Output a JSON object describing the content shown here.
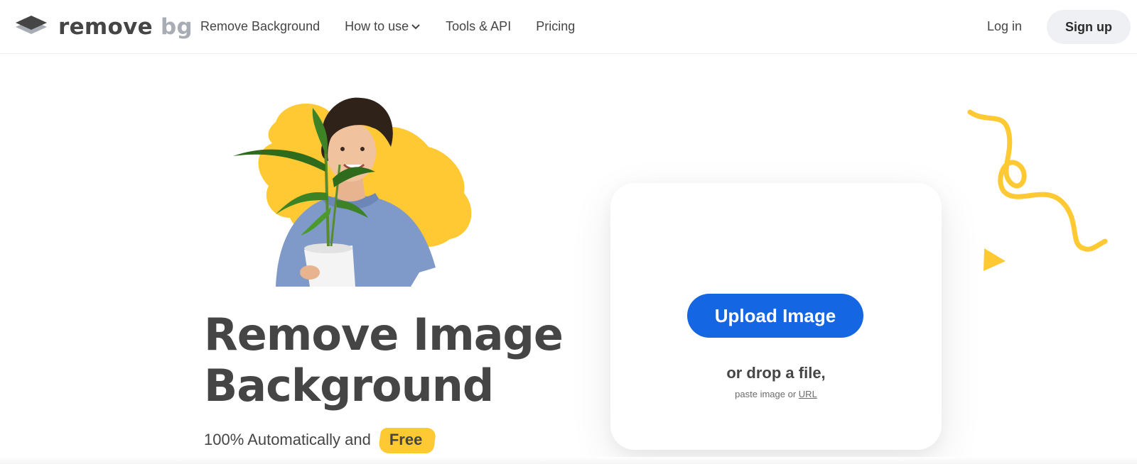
{
  "brand": {
    "name_main": "remove",
    "name_accent": "bg",
    "dark": "#454545",
    "accent_gray": "#a8adb5"
  },
  "nav": {
    "items": [
      {
        "label": "Remove Background"
      },
      {
        "label": "How to use",
        "has_dropdown": true
      },
      {
        "label": "Tools & API"
      },
      {
        "label": "Pricing"
      }
    ],
    "login": "Log in",
    "signup": "Sign up"
  },
  "hero": {
    "headline_line1": "Remove Image",
    "headline_line2": "Background",
    "subline": "100% Automatically and",
    "free_label": "Free",
    "highlight_color": "#ffc933"
  },
  "upload": {
    "button_label": "Upload Image",
    "drop_text": "or drop a file,",
    "paste_prefix": "paste image or",
    "url_label": "URL",
    "button_color": "#1466e3"
  }
}
